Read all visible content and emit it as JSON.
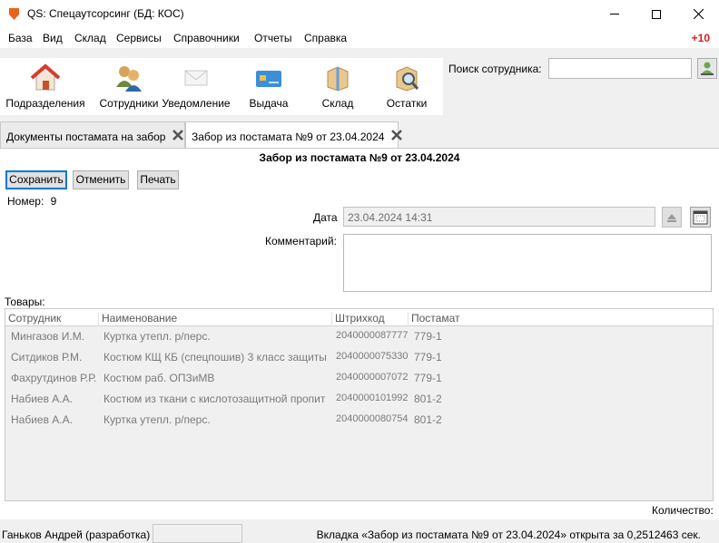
{
  "window": {
    "title": "QS: Спецаутсорсинг (БД: КОС)",
    "minimize": "—",
    "maximize": "☐",
    "close": "✕"
  },
  "menu": {
    "items": [
      "База",
      "Вид",
      "Склад",
      "Сервисы",
      "Справочники",
      "Отчеты",
      "Справка"
    ],
    "notification_count": "+10"
  },
  "toolbar": {
    "items": [
      {
        "label": "Подразделения",
        "icon": "house-icon"
      },
      {
        "label": "Сотрудники",
        "icon": "people-icon"
      },
      {
        "label": "Уведомление",
        "icon": "envelope-icon"
      },
      {
        "label": "Выдача",
        "icon": "card-icon"
      },
      {
        "label": "Склад",
        "icon": "box-icon"
      },
      {
        "label": "Остатки",
        "icon": "box-search-icon"
      }
    ]
  },
  "search": {
    "label": "Поиск сотрудника:",
    "value": ""
  },
  "tabs": [
    {
      "label": "Документы постамата на забор"
    },
    {
      "label": "Забор из постамата №9 от 23.04.2024"
    }
  ],
  "document": {
    "title": "Забор из постамата №9 от 23.04.2024",
    "save_label": "Сохранить",
    "cancel_label": "Отменить",
    "print_label": "Печать",
    "number_label": "Номер:",
    "number_value": "9",
    "date_label": "Дата",
    "date_value": "23.04.2024 14:31",
    "comment_label": "Комментарий:",
    "comment_value": "",
    "goods_label": "Товары:",
    "quantity_label": "Количество:"
  },
  "grid": {
    "columns": [
      "Сотрудник",
      "Наименование",
      "Штрихкод",
      "Постамат"
    ],
    "rows": [
      [
        "Мингазов И.М.",
        "Куртка утепл. р/перс.",
        "2040000087777",
        "779-1"
      ],
      [
        "Ситдиков Р.М.",
        "Костюм КЩ КБ (спецпошив) 3 класс защиты",
        "2040000075330",
        "779-1"
      ],
      [
        "Фахрутдинов Р.Р.",
        "Костюм раб. ОПЗиМВ",
        "2040000007072",
        "779-1"
      ],
      [
        "Набиев А.А.",
        "Костюм из ткани с кислотозащитной пропит",
        "2040000101992",
        "801-2"
      ],
      [
        "Набиев А.А.",
        "Куртка утепл. р/перс.",
        "2040000080754",
        "801-2"
      ]
    ]
  },
  "status": {
    "user": "Ганьков Андрей (разработка)",
    "message": "Вкладка «Забор из постамата №9 от 23.04.2024» открыта за 0,2512463 сек."
  },
  "colors": {
    "accent_red": "#d81e1e",
    "focus_blue": "#0078d7"
  }
}
